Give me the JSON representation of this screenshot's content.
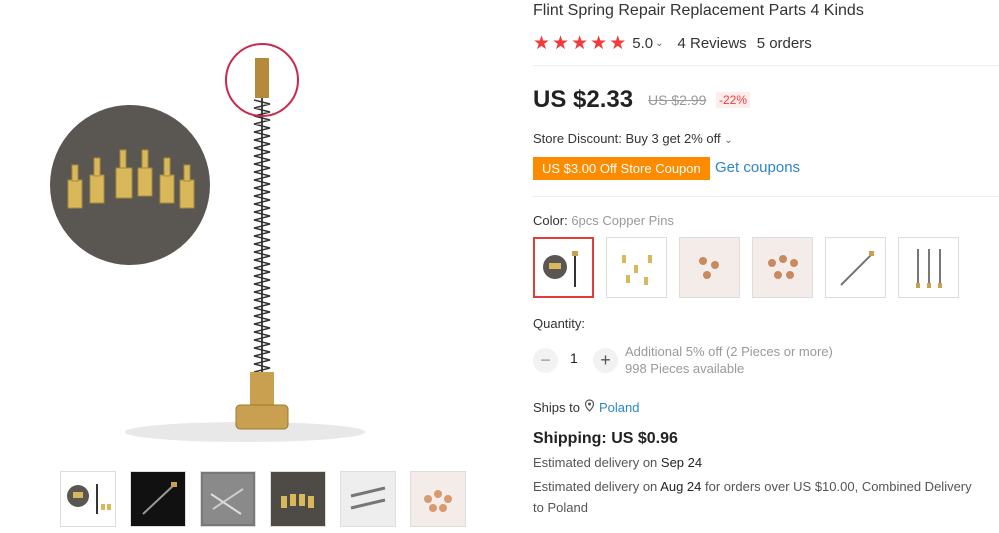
{
  "product": {
    "title": "Flint Spring Repair Replacement Parts 4 Kinds",
    "rating": "5.0",
    "reviews": "4 Reviews",
    "orders": "5 orders",
    "price": "US $2.33",
    "old_price": "US $2.99",
    "discount": "-22%"
  },
  "store": {
    "discount_text": "Store Discount: Buy 3 get 2% off",
    "coupon": "US $3.00 Off Store Coupon",
    "get_coupons": "Get coupons"
  },
  "color": {
    "label": "Color:",
    "selected": "6pcs Copper Pins"
  },
  "quantity": {
    "label": "Quantity:",
    "value": "1",
    "additional": "Additional 5% off (2 Pieces or more)",
    "available": "998 Pieces available"
  },
  "shipping": {
    "ships_to_label": "Ships to",
    "country": "Poland",
    "cost": "Shipping: US $0.96",
    "est1_prefix": "Estimated delivery on",
    "est1_date": "Sep 24",
    "est2_prefix": "Estimated delivery on",
    "est2_date": "Aug 24",
    "est2_suffix": "for orders over US $10.00, Combined Delivery to Poland"
  },
  "colors": {
    "accent_red": "#f23b3b",
    "coupon_orange": "#fd8b00",
    "link_blue": "#2c86c8"
  }
}
